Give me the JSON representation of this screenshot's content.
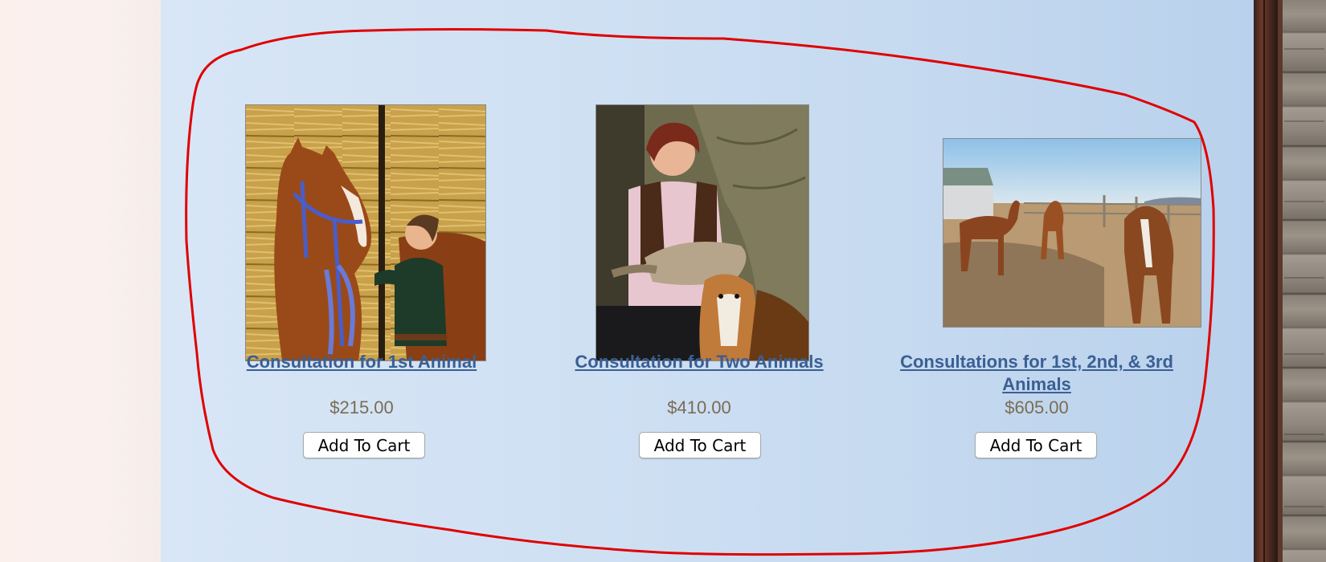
{
  "products": [
    {
      "title": "Consultation for 1st Animal",
      "price": "$215.00",
      "button_label": "Add To Cart",
      "image_icon": "horse-with-woman-photo"
    },
    {
      "title": "Consultation for Two Animals",
      "price": "$410.00",
      "button_label": "Add To Cart",
      "image_icon": "woman-with-cat-and-dog-photo"
    },
    {
      "title": "Consultations for 1st, 2nd, & 3rd Animals",
      "price": "$605.00",
      "button_label": "Add To Cart",
      "image_icon": "three-horses-photo"
    }
  ],
  "colors": {
    "link": "#3b5f93",
    "price": "#7a6c54",
    "panel": "#cfe0f3",
    "annotation": "#e00000"
  }
}
